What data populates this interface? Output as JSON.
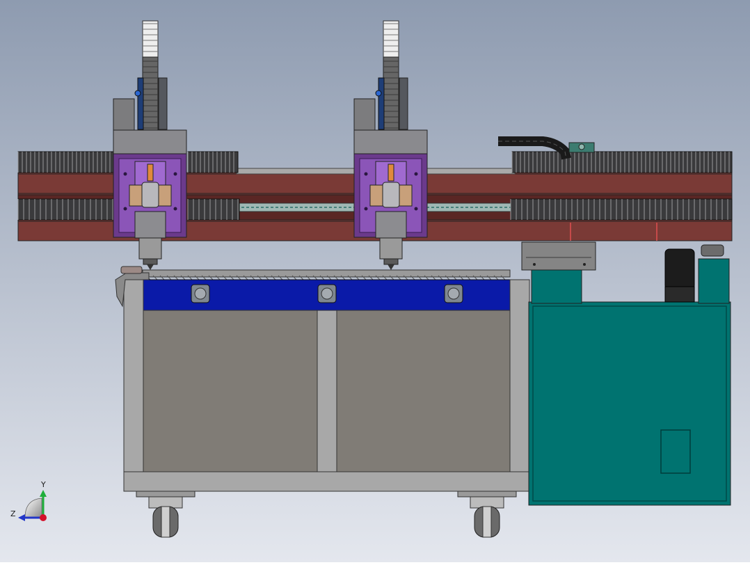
{
  "viewport": {
    "background_top": "#8e9bb0",
    "background_bottom": "#e4e7ee"
  },
  "orientation_triad": {
    "y_label": "Y",
    "z_label": "Z",
    "y_color": "#1fae3a",
    "z_color": "#2236c8",
    "x_color": "#d4102a"
  },
  "colors": {
    "rail": "#7a3a36",
    "rail_dark": "#5a2624",
    "bellows": "#3a3a3c",
    "bellows_light": "#9a9a9c",
    "head_frame": "#6b3a8c",
    "head_inner": "#8b55b8",
    "head_housing": "#8a8a8e",
    "table_blue": "#0a1aa8",
    "cabinet_gray": "#807c76",
    "frame_gray": "#a8a8a8",
    "cabinet_teal": "#007370",
    "cabinet_teal_dark": "#005b58"
  }
}
